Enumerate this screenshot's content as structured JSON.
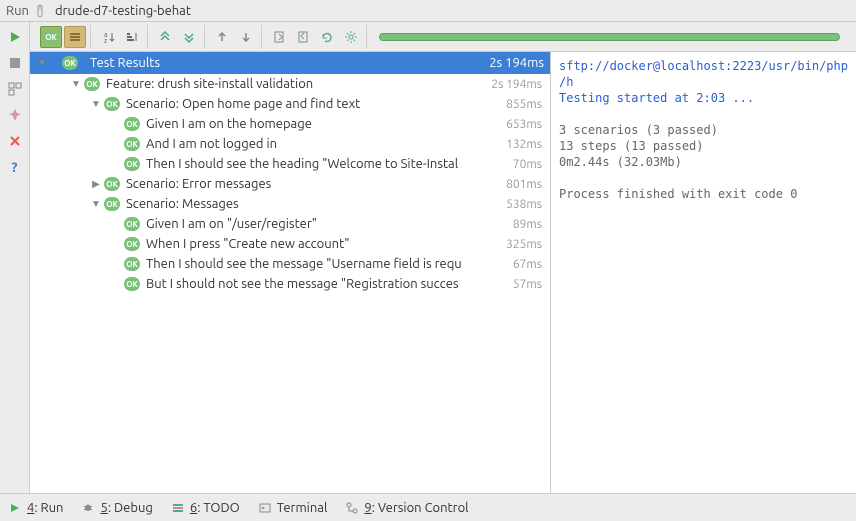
{
  "titlebar": {
    "label": "Run",
    "config": "drude-d7-testing-behat"
  },
  "header": {
    "ok": "OK",
    "title": "Test Results",
    "time": "2s 194ms"
  },
  "tree": [
    {
      "depth": 1,
      "arrow": "down",
      "label": "Feature: drush site-install validation",
      "time": "2s 194ms"
    },
    {
      "depth": 2,
      "arrow": "down",
      "label": "Scenario: Open home page and find text",
      "time": "855ms"
    },
    {
      "depth": 3,
      "arrow": "",
      "label": "Given I am on the homepage",
      "time": "653ms"
    },
    {
      "depth": 3,
      "arrow": "",
      "label": "And I am not logged in",
      "time": "132ms"
    },
    {
      "depth": 3,
      "arrow": "",
      "label": "Then I should see the heading \"Welcome to Site-Instal",
      "time": "70ms"
    },
    {
      "depth": 2,
      "arrow": "right",
      "label": "Scenario: Error messages",
      "time": "801ms"
    },
    {
      "depth": 2,
      "arrow": "down",
      "label": "Scenario: Messages",
      "time": "538ms"
    },
    {
      "depth": 3,
      "arrow": "",
      "label": "Given I am on \"/user/register\"",
      "time": "89ms"
    },
    {
      "depth": 3,
      "arrow": "",
      "label": "When I press \"Create new account\"",
      "time": "325ms"
    },
    {
      "depth": 3,
      "arrow": "",
      "label": "Then I should see the message \"Username field is requ",
      "time": "67ms"
    },
    {
      "depth": 3,
      "arrow": "",
      "label": "But I should not see the message \"Registration succes",
      "time": "57ms"
    }
  ],
  "console": {
    "l1": "sftp://docker@localhost:2223/usr/bin/php /h",
    "l2": "Testing started at 2:03 ...",
    "l3": "3 scenarios (3 passed)",
    "l4": "13 steps (13 passed)",
    "l5": "0m2.44s (32.03Mb)",
    "l6": "Process finished with exit code 0"
  },
  "bottombar": {
    "run": "4: Run",
    "debug": "5: Debug",
    "todo": "6: TODO",
    "terminal": "Terminal",
    "vcs": "9: Version Control"
  }
}
